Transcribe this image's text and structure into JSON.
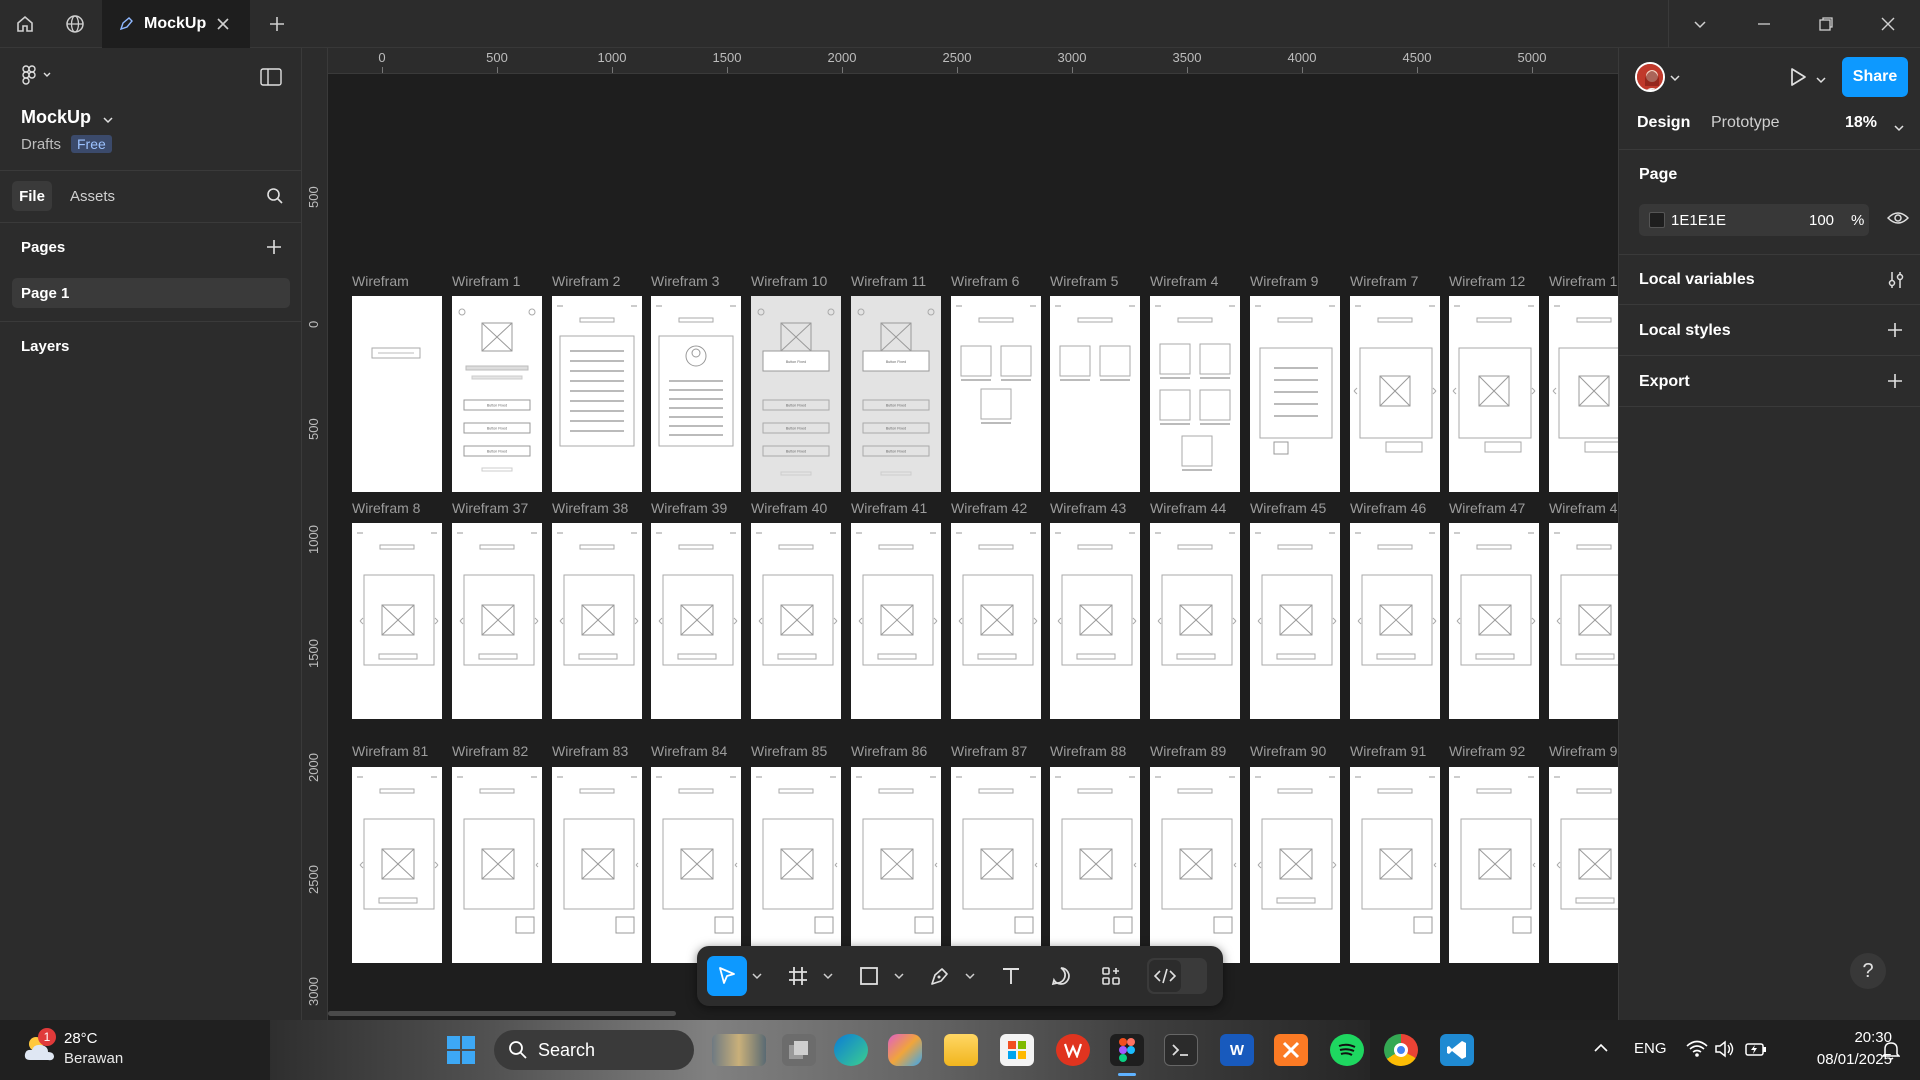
{
  "titlebar": {
    "tab_title": "MockUp"
  },
  "left_panel": {
    "project_name": "MockUp",
    "location": "Drafts",
    "plan_badge": "Free",
    "tabs": [
      "File",
      "Assets"
    ],
    "pages_heading": "Pages",
    "pages": [
      "Page 1"
    ],
    "layers_heading": "Layers"
  },
  "canvas": {
    "ruler_top": [
      "0",
      "500",
      "1000",
      "1500",
      "2000",
      "2500",
      "3000",
      "3500",
      "4000",
      "4500",
      "5000"
    ],
    "ruler_left": [
      "500",
      "0",
      "500",
      "1000",
      "1500",
      "2000",
      "2500",
      "3000"
    ],
    "rows": [
      [
        "Wirefram",
        "Wirefram 1",
        "Wirefram 2",
        "Wirefram 3",
        "Wirefram 10",
        "Wirefram 11",
        "Wirefram 6",
        "Wirefram 5",
        "Wirefram 4",
        "Wirefram 9",
        "Wirefram 7",
        "Wirefram 12",
        "Wirefram 1"
      ],
      [
        "Wirefram 8",
        "Wirefram 37",
        "Wirefram 38",
        "Wirefram 39",
        "Wirefram 40",
        "Wirefram 41",
        "Wirefram 42",
        "Wirefram 43",
        "Wirefram 44",
        "Wirefram 45",
        "Wirefram 46",
        "Wirefram 47",
        "Wirefram 4"
      ],
      [
        "Wirefram 81",
        "Wirefram 82",
        "Wirefram 83",
        "Wirefram 84",
        "Wirefram 85",
        "Wirefram 86",
        "Wirefram 87",
        "Wirefram 88",
        "Wirefram 89",
        "Wirefram 90",
        "Wirefram 91",
        "Wirefram 92",
        "Wirefram 9"
      ]
    ],
    "button_text": "Button Fixed"
  },
  "toolbar": {
    "tools": [
      "move-tool",
      "frame-tool",
      "rectangle-tool",
      "pen-tool",
      "text-tool",
      "comment-tool",
      "actions-tool",
      "dev-mode-toggle"
    ]
  },
  "right_panel": {
    "share_label": "Share",
    "tabs": [
      "Design",
      "Prototype"
    ],
    "zoom": "18%",
    "page_heading": "Page",
    "page_color": "1E1E1E",
    "page_opacity": "100",
    "percent_sign": "%",
    "local_variables": "Local variables",
    "local_styles": "Local styles",
    "export": "Export",
    "help": "?"
  },
  "taskbar": {
    "weather_temp": "28°C",
    "weather_desc": "Berawan",
    "weather_badge": "1",
    "search_label": "Search",
    "language": "ENG",
    "time": "20:30",
    "date": "08/01/2025"
  }
}
